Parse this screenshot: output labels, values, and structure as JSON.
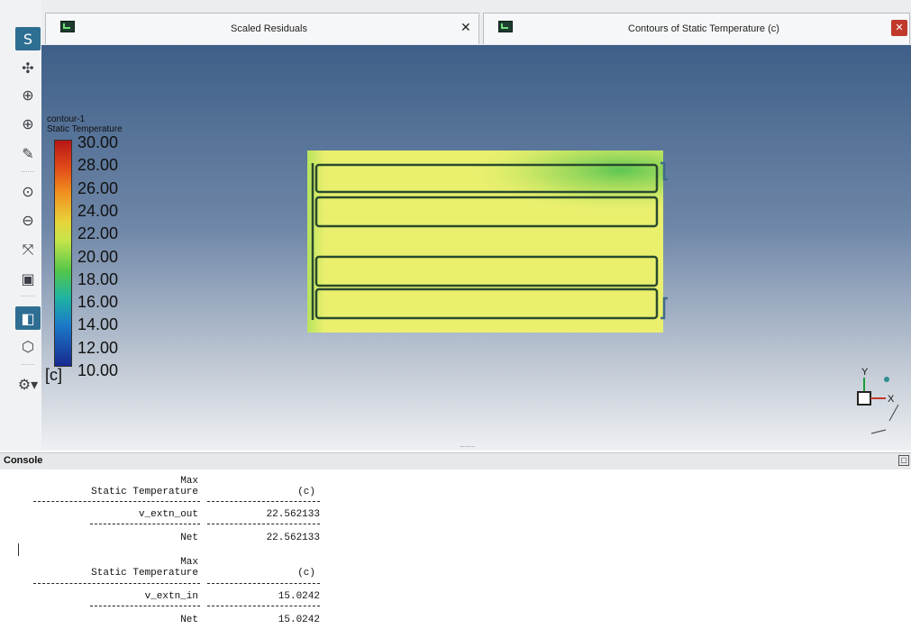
{
  "tabs": [
    {
      "title": "Scaled Residuals",
      "close": "✕"
    },
    {
      "title": "Contours of Static Temperature (c)",
      "close": "✕"
    }
  ],
  "toolbar": {
    "icons": [
      "fluent-logo-icon",
      "pan-icon",
      "rotate-icon",
      "zoom-icon",
      "probe-icon",
      "zoom-to-fit-icon",
      "zoom-out-icon",
      "orient-icon",
      "screenshot-icon",
      "select-icon",
      "view-icon",
      "views-dropdown-icon"
    ]
  },
  "legend": {
    "name": "contour-1",
    "variable": "Static Temperature",
    "ticks": [
      "30.00",
      "28.00",
      "26.00",
      "24.00",
      "22.00",
      "20.00",
      "18.00",
      "16.00",
      "14.00",
      "12.00",
      "10.00"
    ],
    "unit": "[c]"
  },
  "triad": {
    "y": "Y",
    "x": "X"
  },
  "console": {
    "title": "Console",
    "reports": [
      {
        "header1": "Max",
        "header2": "Static Temperature",
        "unit": "(c)",
        "zone": "v_extn_out",
        "value": "22.562133",
        "net_label": "Net",
        "net_value": "22.562133"
      },
      {
        "header1": "Max",
        "header2": "Static Temperature",
        "unit": "(c)",
        "zone": "v_extn_in",
        "value": "15.0242",
        "net_label": "Net",
        "net_value": "15.0242"
      }
    ]
  },
  "colors": {
    "accent": "#2f6e93",
    "contour_high": "#b71616",
    "contour_low": "#172a8f",
    "field_main": "#eaf06e",
    "field_warm_spot": "#6fcf57"
  }
}
